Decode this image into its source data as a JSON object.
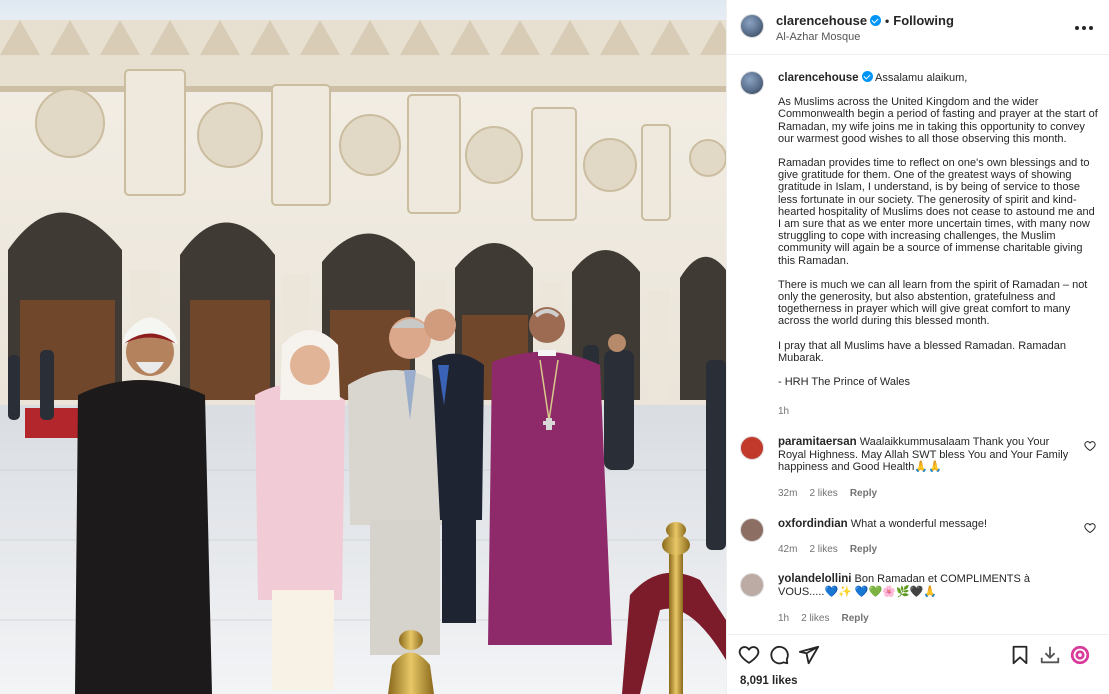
{
  "post": {
    "username": "clarencehouse",
    "follow_separator": "•",
    "follow_status": "Following",
    "location": "Al-Azhar Mosque"
  },
  "caption": {
    "username": "clarencehouse",
    "greeting": "Assalamu alaikum,",
    "paragraphs": [
      "As Muslims across the United Kingdom and the wider Commonwealth begin a period of fasting and prayer at the start of Ramadan, my wife joins me in taking this opportunity to convey our warmest good wishes to all those observing this month.",
      "Ramadan provides time to reflect on one's own blessings and to give gratitude for them. One of the greatest ways of showing gratitude in Islam, I understand, is by being of service to those less fortunate in our society. The generosity of spirit and kind-hearted hospitality of Muslims does not cease to astound me and I am sure that as we enter more uncertain times, with many now struggling to cope with increasing challenges, the Muslim community will again be a source of immense charitable giving this Ramadan.",
      "There is much we can all learn from the spirit of Ramadan – not only the generosity, but also abstention, gratefulness and togetherness in prayer which will give great comfort to many across the world during this blessed month.",
      "I pray that all Muslims have a blessed Ramadan. Ramadan Mubarak.",
      "- HRH The Prince of Wales"
    ],
    "time": "1h"
  },
  "comments": [
    {
      "username": "paramitaersan",
      "text": "Waalaikkummusalaam Thank you Your Royal Highness. May Allah SWT bless You and Your Family happiness and Good Health🙏🙏",
      "time": "32m",
      "likes": "2 likes",
      "reply": "Reply",
      "avatar_color": "#c0392b"
    },
    {
      "username": "oxfordindian",
      "text": "What a wonderful message!",
      "time": "42m",
      "likes": "2 likes",
      "reply": "Reply",
      "avatar_color": "#8d6e63"
    },
    {
      "username": "yolandelollini",
      "text": "Bon Ramadan et COMPLIMENTS à VOUS.....💙✨ 💙💚🌸🌿🖤🙏",
      "time": "1h",
      "likes": "2 likes",
      "reply": "Reply",
      "avatar_color": "#bcaaa4"
    }
  ],
  "actions": {
    "icons": [
      "heart-icon",
      "comment-icon",
      "share-icon",
      "bookmark-icon",
      "download-icon",
      "extension-icon"
    ],
    "likes_count": "8,091 likes"
  },
  "colors": {
    "verified": "#0095f6",
    "text": "#262626",
    "secondary": "#737373",
    "bishop_robe": "#8e2a6a"
  }
}
